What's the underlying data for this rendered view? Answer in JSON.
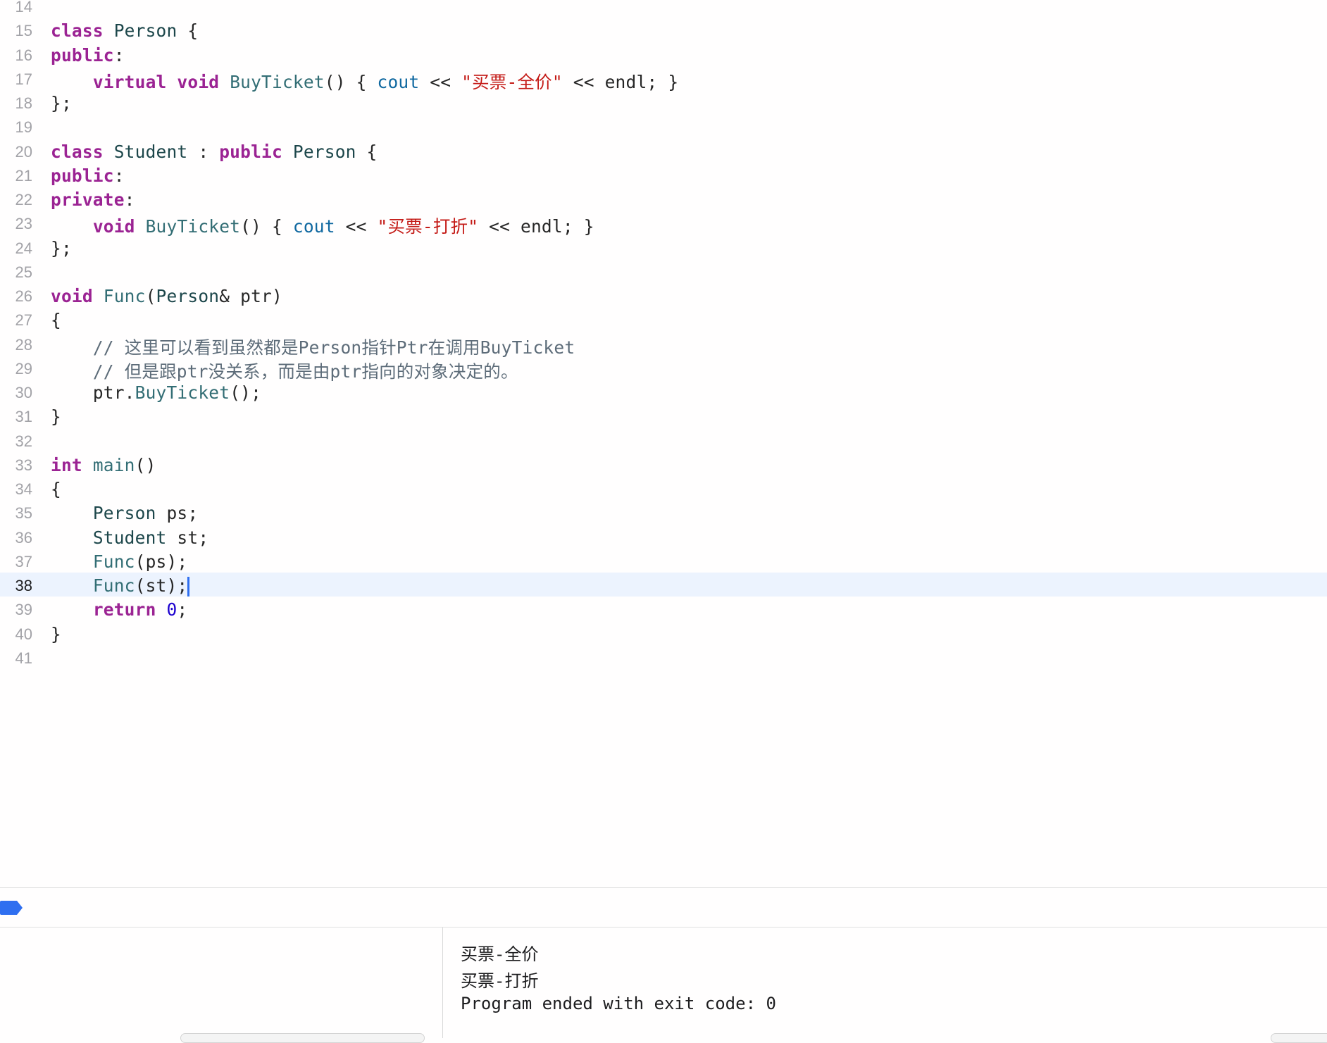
{
  "editor": {
    "current_line": "38",
    "lines": [
      {
        "num": "14",
        "code": ""
      },
      {
        "num": "15",
        "code": "class Person {"
      },
      {
        "num": "16",
        "code": "public:"
      },
      {
        "num": "17",
        "code": "    virtual void BuyTicket() { cout << \"买票-全价\" << endl; }"
      },
      {
        "num": "18",
        "code": "};"
      },
      {
        "num": "19",
        "code": ""
      },
      {
        "num": "20",
        "code": "class Student : public Person {"
      },
      {
        "num": "21",
        "code": "public:"
      },
      {
        "num": "22",
        "code": "private:"
      },
      {
        "num": "23",
        "code": "    void BuyTicket() { cout << \"买票-打折\" << endl; }"
      },
      {
        "num": "24",
        "code": "};"
      },
      {
        "num": "25",
        "code": ""
      },
      {
        "num": "26",
        "code": "void Func(Person& ptr)"
      },
      {
        "num": "27",
        "code": "{"
      },
      {
        "num": "28",
        "code": "    // 这里可以看到虽然都是Person指针Ptr在调用BuyTicket"
      },
      {
        "num": "29",
        "code": "    // 但是跟ptr没关系，而是由ptr指向的对象决定的。"
      },
      {
        "num": "30",
        "code": "    ptr.BuyTicket();"
      },
      {
        "num": "31",
        "code": "}"
      },
      {
        "num": "32",
        "code": ""
      },
      {
        "num": "33",
        "code": "int main()"
      },
      {
        "num": "34",
        "code": "{"
      },
      {
        "num": "35",
        "code": "    Person ps;"
      },
      {
        "num": "36",
        "code": "    Student st;"
      },
      {
        "num": "37",
        "code": "    Func(ps);"
      },
      {
        "num": "38",
        "code": "    Func(st);"
      },
      {
        "num": "39",
        "code": "    return 0;"
      },
      {
        "num": "40",
        "code": "}"
      },
      {
        "num": "41",
        "code": ""
      }
    ]
  },
  "console": {
    "output": [
      "买票-全价",
      "买票-打折",
      "Program ended with exit code: 0"
    ]
  },
  "colors": {
    "keyword": "#9b2393",
    "type": "#1c464a",
    "function": "#326d74",
    "string": "#c41a16",
    "number": "#1c00cf",
    "comment": "#5d6c79",
    "current_line_bg": "#ecf3fe",
    "breakpoint": "#2f6ff0"
  },
  "icons": {
    "debug_marker": "breakpoint-arrow-icon"
  }
}
